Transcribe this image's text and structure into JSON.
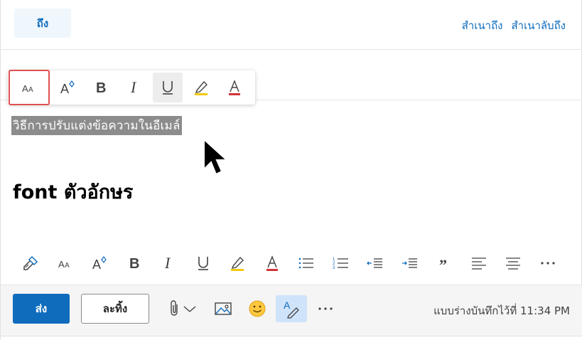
{
  "recipients": {
    "to_label": "ถึง",
    "cc_label": "สำเนาถึง",
    "bcc_label": "สำเนาลับถึง"
  },
  "body": {
    "selected_text": "วิธีการปรับแต่งข้อความในอีเมล์",
    "heading_text": "font ตัวอักษร"
  },
  "floating_toolbar": {
    "items": [
      "font-size-icon",
      "font-grow-icon",
      "bold-icon",
      "italic-icon",
      "underline-icon",
      "highlight-icon",
      "font-color-icon"
    ],
    "highlighted_item": "font-size-icon",
    "active_item": "underline-icon"
  },
  "bottom_toolbar": {
    "items": [
      "format-painter-icon",
      "font-size-icon",
      "font-grow-icon",
      "bold-icon",
      "italic-icon",
      "underline-icon",
      "highlight-icon",
      "font-color-icon",
      "bullets-icon",
      "numbering-icon",
      "decrease-indent-icon",
      "increase-indent-icon",
      "quote-icon",
      "align-left-icon",
      "align-center-icon",
      "more-icon"
    ]
  },
  "actions": {
    "send_label": "ส่ง",
    "discard_label": "ละทิ้ง",
    "draft_status": "แบบร่างบันทึกไว้ที่ 11:34 PM"
  },
  "colors": {
    "accent": "#0f6cbd",
    "highlight_border": "#e05050",
    "highlighter_yellow": "#f2c811",
    "font_color_red": "#d13438"
  }
}
